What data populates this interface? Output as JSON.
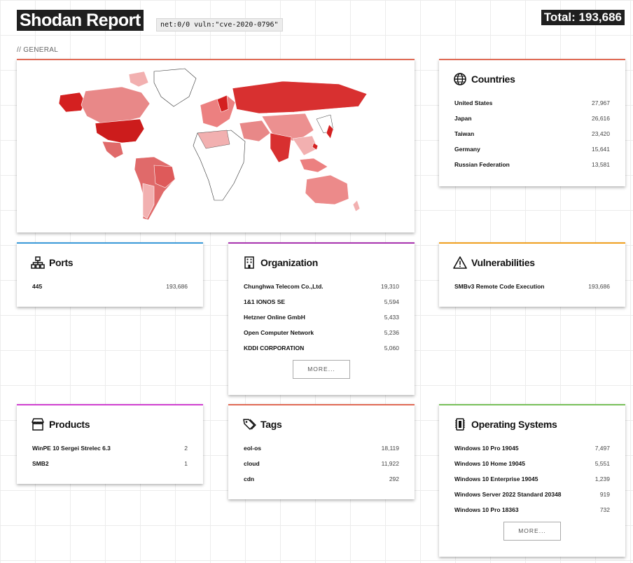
{
  "header": {
    "title": "Shodan Report",
    "query": "net:0/0 vuln:\"cve-2020-0796\"",
    "total": "Total: 193,686"
  },
  "section": {
    "label": "// GENERAL"
  },
  "colors": {
    "accent_red": "#e06a55",
    "accent_blue": "#3b9ad9",
    "accent_purple": "#a935b0",
    "accent_orange": "#f0a020",
    "accent_magenta": "#d040d0",
    "accent_green": "#78c05a",
    "map_dark": "#d42020",
    "map_light": "#f2b0b0"
  },
  "countries": {
    "title": "Countries",
    "icon": "globe-icon",
    "rows": [
      {
        "name": "United States",
        "value": "27,967"
      },
      {
        "name": "Japan",
        "value": "26,616"
      },
      {
        "name": "Taiwan",
        "value": "23,420"
      },
      {
        "name": "Germany",
        "value": "15,641"
      },
      {
        "name": "Russian Federation",
        "value": "13,581"
      }
    ]
  },
  "ports": {
    "title": "Ports",
    "icon": "network-icon",
    "rows": [
      {
        "name": "445",
        "value": "193,686"
      }
    ]
  },
  "organization": {
    "title": "Organization",
    "icon": "building-icon",
    "rows": [
      {
        "name": "Chunghwa Telecom Co.,Ltd.",
        "value": "19,310"
      },
      {
        "name": "1&1 IONOS SE",
        "value": "5,594"
      },
      {
        "name": "Hetzner Online GmbH",
        "value": "5,433"
      },
      {
        "name": "Open Computer Network",
        "value": "5,236"
      },
      {
        "name": "KDDI CORPORATION",
        "value": "5,060"
      }
    ],
    "more_label": "MORE..."
  },
  "vulnerabilities": {
    "title": "Vulnerabilities",
    "icon": "warning-icon",
    "rows": [
      {
        "name": "SMBv3 Remote Code Execution",
        "value": "193,686"
      }
    ]
  },
  "products": {
    "title": "Products",
    "icon": "store-icon",
    "rows": [
      {
        "name": "WinPE 10 Sergei Strelec 6.3",
        "value": "2"
      },
      {
        "name": "SMB2",
        "value": "1"
      }
    ]
  },
  "tags": {
    "title": "Tags",
    "icon": "tags-icon",
    "rows": [
      {
        "name": "eol-os",
        "value": "18,119"
      },
      {
        "name": "cloud",
        "value": "11,922"
      },
      {
        "name": "cdn",
        "value": "292"
      }
    ]
  },
  "operating_systems": {
    "title": "Operating Systems",
    "icon": "chip-icon",
    "rows": [
      {
        "name": "Windows 10 Pro 19045",
        "value": "7,497"
      },
      {
        "name": "Windows 10 Home 19045",
        "value": "5,551"
      },
      {
        "name": "Windows 10 Enterprise 19045",
        "value": "1,239"
      },
      {
        "name": "Windows Server 2022 Standard 20348",
        "value": "919"
      },
      {
        "name": "Windows 10 Pro 18363",
        "value": "732"
      }
    ],
    "more_label": "MORE..."
  }
}
